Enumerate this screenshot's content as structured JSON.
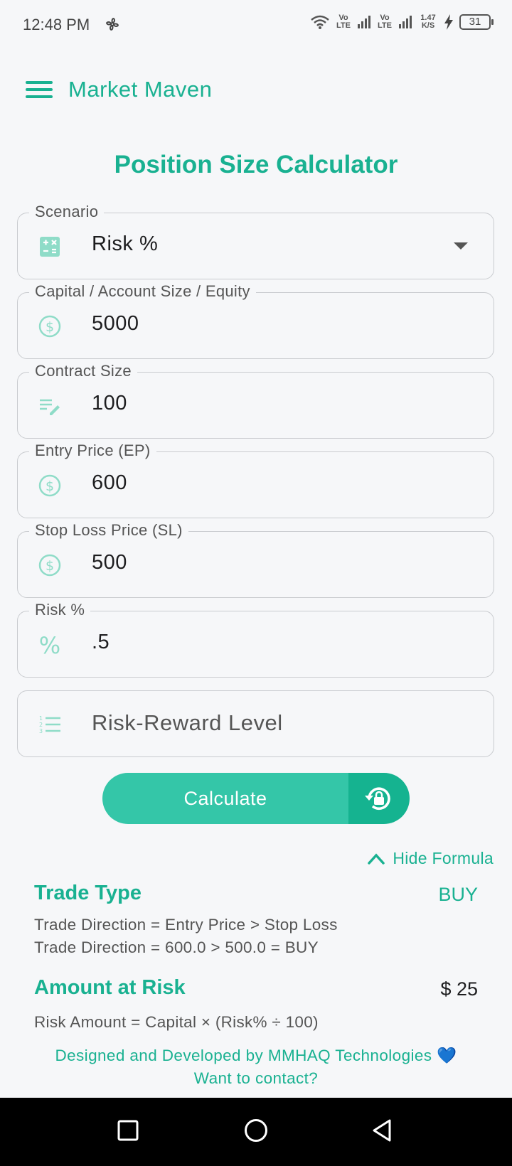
{
  "status_bar": {
    "time": "12:48 PM",
    "net1": "Vo LTE",
    "net2": "Vo LTE",
    "speed": "1.47 K/S",
    "battery": "31"
  },
  "app": {
    "title": "Market Maven"
  },
  "page": {
    "title": "Position Size Calculator"
  },
  "fields": {
    "scenario": {
      "label": "Scenario",
      "value": "Risk %"
    },
    "capital": {
      "label": "Capital / Account Size / Equity",
      "value": "5000"
    },
    "contract": {
      "label": "Contract Size",
      "value": "100"
    },
    "entry": {
      "label": "Entry Price (EP)",
      "value": "600"
    },
    "stop": {
      "label": "Stop Loss Price (SL)",
      "value": "500"
    },
    "risk": {
      "label": "Risk %",
      "value": ".5"
    },
    "rr": {
      "placeholder": "Risk-Reward Level"
    }
  },
  "actions": {
    "calculate": "Calculate",
    "hide_formula": "Hide Formula"
  },
  "results": {
    "trade_type": {
      "title": "Trade Type",
      "value": "BUY",
      "formula1": "Trade Direction = Entry Price > Stop Loss",
      "formula2": "Trade Direction = 600.0 > 500.0 = BUY"
    },
    "amount_at_risk": {
      "title": "Amount at Risk",
      "value": "$ 25",
      "formula": "Risk Amount = Capital × (Risk% ÷ 100)"
    }
  },
  "footer": {
    "credit": "Designed and Developed by MMHAQ Technologies",
    "heart": "💙",
    "contact": "Want to contact?"
  },
  "colors": {
    "accent": "#19b191",
    "button": "#34c6a8",
    "button_dark": "#15b390",
    "icon": "#8fdcc8"
  }
}
